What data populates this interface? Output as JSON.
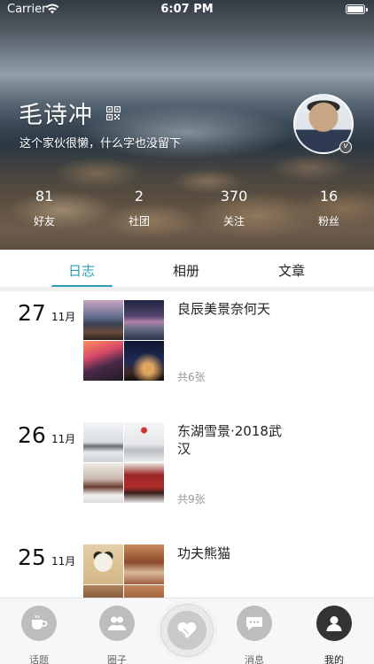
{
  "status_bar": {
    "carrier": "Carrier",
    "time": "6:07 PM"
  },
  "profile": {
    "name": "毛诗冲",
    "bio": "这个家伙很懒，什么字也没留下",
    "badge": "v"
  },
  "stats": [
    {
      "value": "81",
      "label": "好友"
    },
    {
      "value": "2",
      "label": "社团"
    },
    {
      "value": "370",
      "label": "关注"
    },
    {
      "value": "16",
      "label": "粉丝"
    }
  ],
  "tabs": [
    {
      "label": "日志",
      "active": true
    },
    {
      "label": "相册",
      "active": false
    },
    {
      "label": "文章",
      "active": false
    }
  ],
  "entries": [
    {
      "day": "27",
      "month": "11月",
      "title": "良辰美景奈何天",
      "count": "共6张"
    },
    {
      "day": "26",
      "month": "11月",
      "title": "东湖雪景·2018武汉",
      "count": "共9张"
    },
    {
      "day": "25",
      "month": "11月",
      "title": "功夫熊猫",
      "count": ""
    }
  ],
  "bottom_nav": [
    {
      "label": "话题",
      "icon": "coffee-cup-icon",
      "active": false
    },
    {
      "label": "圈子",
      "icon": "group-icon",
      "active": false
    },
    {
      "label": "",
      "icon": "heart-hands-icon",
      "active": false
    },
    {
      "label": "消息",
      "icon": "message-bubble-icon",
      "active": false
    },
    {
      "label": "我的",
      "icon": "person-icon",
      "active": true
    }
  ],
  "colors": {
    "accent": "#2ba0b5",
    "active_nav": "#333333",
    "inactive_nav": "#bdbdbd"
  }
}
